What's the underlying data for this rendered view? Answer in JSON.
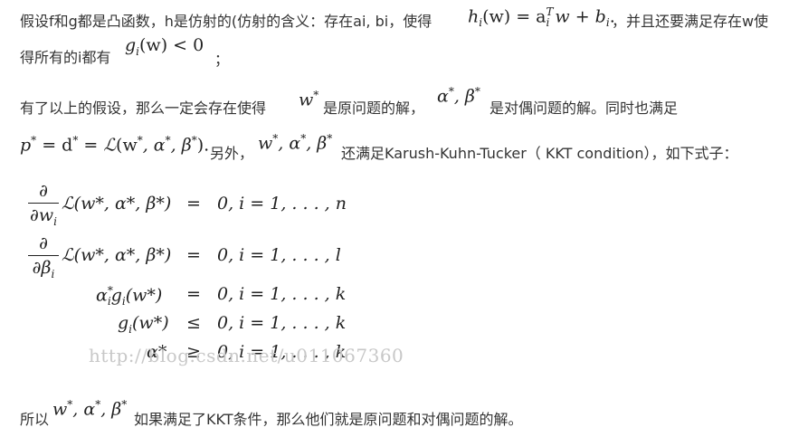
{
  "p1": {
    "t1": "假设f和g都是凸函数，h是仿射的(仿射的含义：存在ai, bi，使得",
    "m1": "h",
    "m1b": "i",
    "m1c": "(w) = a",
    "m1d": "T",
    "m1e": "i",
    "m1f": " w + b",
    "m1g": "i",
    "m1h": ".",
    "t2": "，并且还要满足存在w使",
    "t3": "得所有的i都有",
    "m2": "g",
    "m2b": "i",
    "m2c": "(w) < 0",
    "t4": "；"
  },
  "p2": {
    "t1": "有了以上的假设，那么一定会存在使得",
    "m1": "w",
    "m1s": "*",
    "t2": "是原问题的解，",
    "m2": "α",
    "m2s": "*",
    "m2c": ", β",
    "m2d": "*",
    "t3": "是对偶问题的解。同时也满足"
  },
  "p3": {
    "m1": "p",
    "m1s": "*",
    "m1c": " = d",
    "m1d": "*",
    "m1e": " = ",
    "m1f": "ℒ",
    "m1g": "(w",
    "m1h": "*",
    "m1i": ", α",
    "m1j": "*",
    "m1k": ", β",
    "m1l": "*",
    "m1m": ").",
    "t1": "另外，",
    "m2": "w",
    "m2s": "*",
    "m2c": ", α",
    "m2d": "*",
    "m2e": ", β",
    "m2f": "*",
    "t2": "还满足Karush-Kuhn-Tucker（ KKT condition），如下式子："
  },
  "eq": {
    "r1_num": "∂",
    "r1_den": "∂w",
    "r1_den_sub": "i",
    "r1_lhs": "ℒ(w*, α*, β*)",
    "r1_rel": "=",
    "r1_rhs": "0,  i = 1, . . . , n",
    "r2_num": "∂",
    "r2_den": "∂β",
    "r2_den_sub": "i",
    "r2_lhs": "ℒ(w*, α*, β*)",
    "r2_rel": "=",
    "r2_rhs": "0,  i = 1, . . . , l",
    "r3_lhs": "α",
    "r3_lhs_sup": "*",
    "r3_lhs_sub": "i",
    "r3_lhs2": "g",
    "r3_lhs2_sub": "i",
    "r3_lhs3": "(w*)",
    "r3_rel": "=",
    "r3_rhs": "0,  i = 1, . . . , k",
    "r4_lhs": "g",
    "r4_lhs_sub": "i",
    "r4_lhs2": "(w*)",
    "r4_rel": "≤",
    "r4_rhs": "0,  i = 1, . . . , k",
    "r5_lhs": "α*",
    "r5_rel": "≥",
    "r5_rhs": "0,  i = 1, . . . , k"
  },
  "watermark": "http://blog.csdn.net/u011067360",
  "p4": {
    "t1": "所以",
    "m1": "w",
    "m1s": "*",
    "m1c": ", α",
    "m1d": "*",
    "m1e": ", β",
    "m1f": "*",
    "t2": "如果满足了KKT条件，那么他们就是原问题和对偶问题的解。"
  }
}
